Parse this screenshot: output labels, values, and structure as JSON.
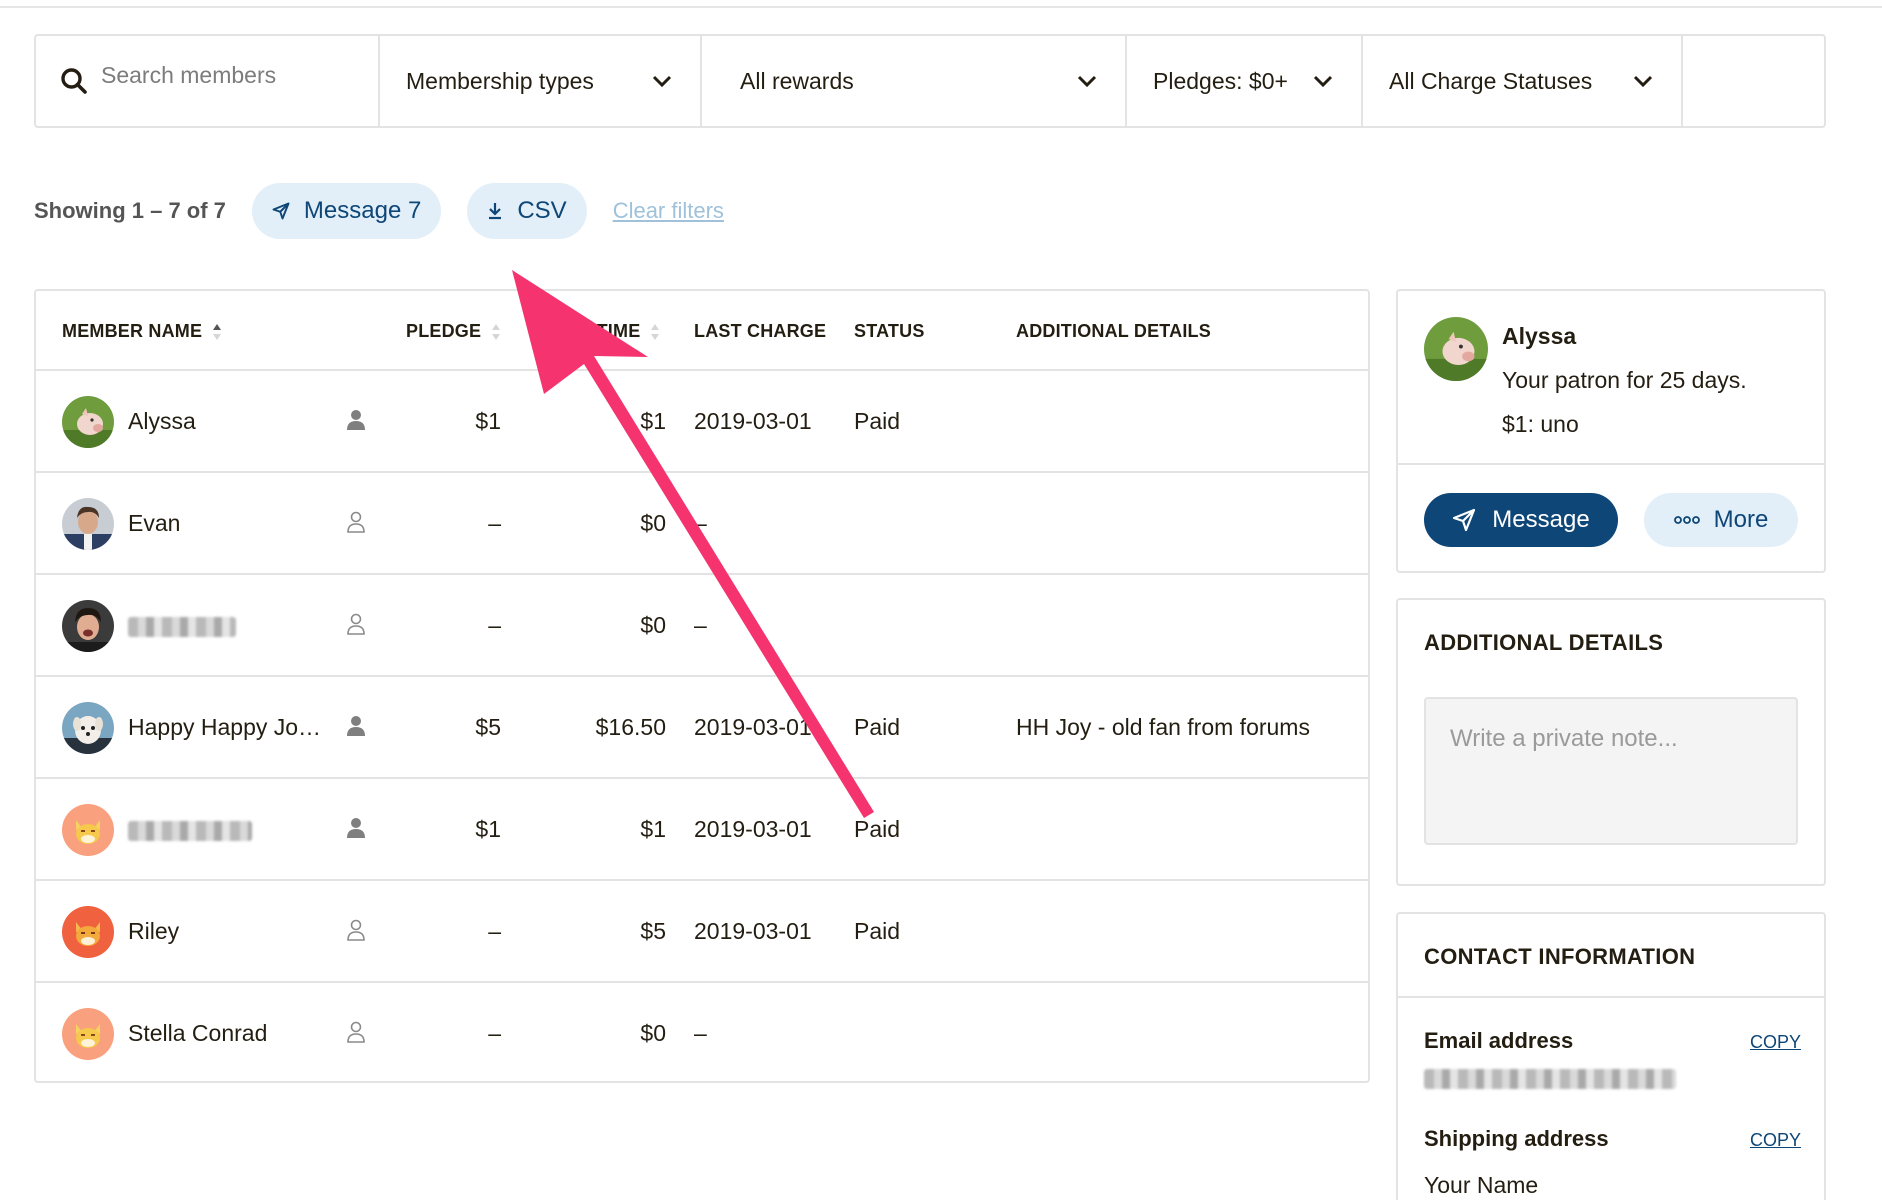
{
  "search": {
    "placeholder": "Search members"
  },
  "filters": {
    "membership_types": "Membership types",
    "rewards": "All rewards",
    "pledges": "Pledges: $0+",
    "charge_statuses": "All Charge Statuses"
  },
  "toolbar": {
    "showing": "Showing 1 – 7 of 7",
    "message_label": "Message 7",
    "csv_label": "CSV",
    "clear_filters": "Clear filters"
  },
  "table": {
    "columns": {
      "member_name": "MEMBER NAME",
      "pledge": "PLEDGE",
      "lifetime": "IFETIME",
      "last_charge": "LAST CHARGE",
      "status": "STATUS",
      "additional_details": "ADDITIONAL DETAILS"
    },
    "rows": [
      {
        "name": "Alyssa",
        "pledge": "$1",
        "lifetime": "$1",
        "last_charge": "2019-03-01",
        "status": "Paid",
        "details": "",
        "avatar": "piglet-photo",
        "member_icon": "person-filled-icon"
      },
      {
        "name": "Evan",
        "pledge": "–",
        "lifetime": "$0",
        "last_charge": "–",
        "status": "",
        "details": "",
        "avatar": "man-photo",
        "member_icon": "person-outline-icon"
      },
      {
        "name": "",
        "pledge": "–",
        "lifetime": "$0",
        "last_charge": "–",
        "status": "",
        "details": "",
        "avatar": "laughing-man-photo",
        "member_icon": "person-outline-icon"
      },
      {
        "name": "Happy Happy Jo…",
        "pledge": "$5",
        "lifetime": "$16.50",
        "last_charge": "2019-03-01",
        "status": "Paid",
        "details": "HH Joy - old fan from forums",
        "avatar": "puppy-photo",
        "member_icon": "person-filled-icon"
      },
      {
        "name": "",
        "pledge": "$1",
        "lifetime": "$1",
        "last_charge": "2019-03-01",
        "status": "Paid",
        "details": "",
        "avatar": "orange-cat-default",
        "member_icon": "person-filled-icon"
      },
      {
        "name": "Riley",
        "pledge": "–",
        "lifetime": "$5",
        "last_charge": "2019-03-01",
        "status": "Paid",
        "details": "",
        "avatar": "red-cat-default",
        "member_icon": "person-outline-icon"
      },
      {
        "name": "Stella Conrad",
        "pledge": "–",
        "lifetime": "$0",
        "last_charge": "–",
        "status": "",
        "details": "",
        "avatar": "orange-cat-default",
        "member_icon": "person-outline-icon"
      }
    ]
  },
  "member_panel": {
    "name": "Alyssa",
    "patron_duration": "Your patron for 25 days.",
    "tier": "$1: uno",
    "message_button": "Message",
    "more_button": "More"
  },
  "details_panel": {
    "title": "ADDITIONAL DETAILS",
    "note_placeholder": "Write a private note..."
  },
  "contact_panel": {
    "title": "CONTACT INFORMATION",
    "email_label": "Email address",
    "copy_label": "COPY",
    "shipping_label": "Shipping address",
    "shipping_name": "Your Name"
  },
  "colors": {
    "brand_navy": "#0d4677",
    "pill_bg": "#e2eff8",
    "annotation_arrow": "#f4336f",
    "border": "#e3e3e3"
  }
}
